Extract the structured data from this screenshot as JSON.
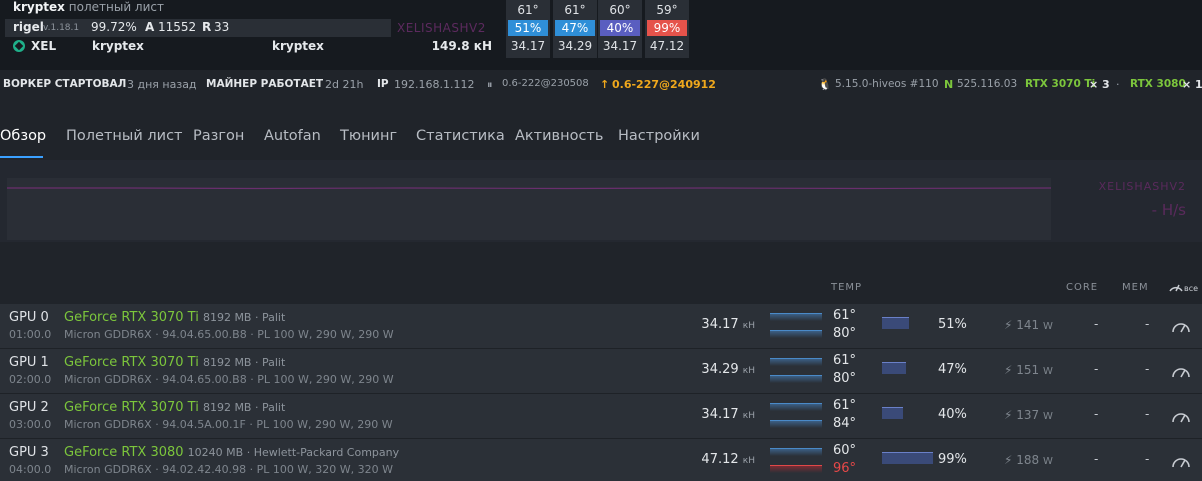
{
  "header": {
    "worker": "kryptex",
    "sheet": "полетный лист",
    "miner": "rigel",
    "miner_ver": "v.1.18.1",
    "efficiency": "99.72%",
    "accepted_key": "A",
    "accepted": "11552",
    "rejected_key": "R",
    "rejected": "33",
    "watermark": "XELISHASHV2",
    "coin": "XEL",
    "pool": "kryptex",
    "wallet": "kryptex",
    "hashrate": "149.8 кН",
    "gpu_cols": [
      {
        "temp": "61°",
        "fan": "51%",
        "hash": "34.17",
        "color": "#2f8fd8"
      },
      {
        "temp": "61°",
        "fan": "47%",
        "hash": "34.29",
        "color": "#2f8fd8"
      },
      {
        "temp": "60°",
        "fan": "40%",
        "hash": "34.17",
        "color": "#5a5ec0"
      },
      {
        "temp": "59°",
        "fan": "99%",
        "hash": "47.12",
        "color": "#e5534b"
      }
    ]
  },
  "status": {
    "worker_started_k": "ВОРКЕР СТАРТОВАЛ",
    "worker_started_v": "3 дня назад",
    "miner_running_k": "МАЙНЕР РАБОТАЕТ",
    "miner_running_v": "2d 21h",
    "ip_k": "IP",
    "ip_v": "192.168.1.112",
    "version": "0.6-222@230508",
    "update": "0.6-227@240912",
    "kernel": "5.15.0-hiveos #110",
    "driver_k": "N",
    "driver_v": "525.116.03",
    "gpu_a": "RTX 3070 Ti",
    "gpu_a_count": "× 3",
    "gpu_b": "RTX 3080",
    "gpu_b_count": "× 1"
  },
  "tabs": [
    "Обзор",
    "Полетный лист",
    "Разгон",
    "Autofan",
    "Тюнинг",
    "Статистика",
    "Активность",
    "Настройки"
  ],
  "chart": {
    "algo": "XELISHASHV2",
    "rate": "- H/s"
  },
  "table_header": {
    "temp": "TEMP",
    "core": "CORE",
    "mem": "MEM",
    "all": "все"
  },
  "gpus": [
    {
      "id": "GPU 0",
      "bus": "01:00.0",
      "name": "GeForce RTX 3070 Ti",
      "vram": "8192 MB · Palit",
      "mem": "Micron GDDR6X · 94.04.65.00.B8 · PL 100 W, 290 W, 290 W",
      "hash": "34.17",
      "unit": "кН",
      "t1": "61°",
      "t2": "80°",
      "t2_hot": false,
      "fan": "51%",
      "fan_level": 0.51,
      "power": "141",
      "w": "W",
      "core": "-",
      "memc": "-"
    },
    {
      "id": "GPU 1",
      "bus": "02:00.0",
      "name": "GeForce RTX 3070 Ti",
      "vram": "8192 MB · Palit",
      "mem": "Micron GDDR6X · 94.04.65.00.B8 · PL 100 W, 290 W, 290 W",
      "hash": "34.29",
      "unit": "кН",
      "t1": "61°",
      "t2": "80°",
      "t2_hot": false,
      "fan": "47%",
      "fan_level": 0.47,
      "power": "151",
      "w": "W",
      "core": "-",
      "memc": "-"
    },
    {
      "id": "GPU 2",
      "bus": "03:00.0",
      "name": "GeForce RTX 3070 Ti",
      "vram": "8192 MB · Palit",
      "mem": "Micron GDDR6X · 94.04.5A.00.1F · PL 100 W, 290 W, 290 W",
      "hash": "34.17",
      "unit": "кН",
      "t1": "61°",
      "t2": "84°",
      "t2_hot": false,
      "fan": "40%",
      "fan_level": 0.4,
      "power": "137",
      "w": "W",
      "core": "-",
      "memc": "-"
    },
    {
      "id": "GPU 3",
      "bus": "04:00.0",
      "name": "GeForce RTX 3080",
      "vram": "10240 MB · Hewlett-Packard Company",
      "mem": "Micron GDDR6X · 94.02.42.40.98 · PL 100 W, 320 W, 320 W",
      "hash": "47.12",
      "unit": "кН",
      "t1": "60°",
      "t2": "96°",
      "t2_hot": true,
      "fan": "99%",
      "fan_level": 0.99,
      "power": "188",
      "w": "W",
      "core": "-",
      "memc": "-"
    }
  ]
}
